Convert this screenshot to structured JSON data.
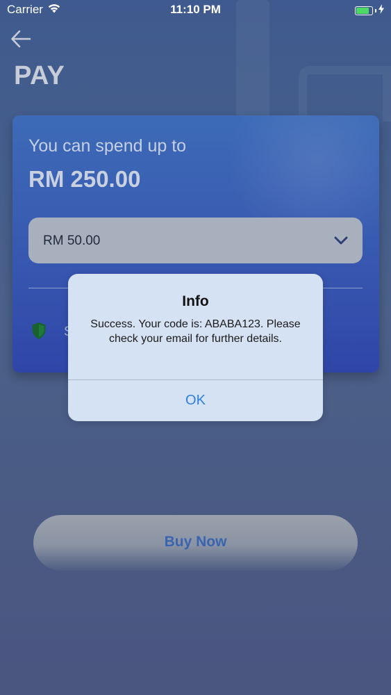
{
  "status_bar": {
    "carrier": "Carrier",
    "time": "11:10 PM",
    "battery_level": 0.8,
    "battery_color": "#4cd964"
  },
  "header": {
    "back_icon": "arrow-left-icon",
    "title": "PAY"
  },
  "card": {
    "spend_label": "You can spend up to",
    "spend_amount": "RM 250.00",
    "amount_select": {
      "value": "RM 50.00",
      "icon": "chevron-down-icon"
    },
    "secure_icon": "shield-icon",
    "secure_text": "S",
    "accent_color": "#3858b0"
  },
  "buy_button": {
    "label": "Buy Now",
    "label_color": "#3a63b0"
  },
  "alert": {
    "title": "Info",
    "message": "Success. Your code is: ABABA123. Please check your email for further details.",
    "ok_label": "OK",
    "ok_color": "#2f7ee0"
  }
}
